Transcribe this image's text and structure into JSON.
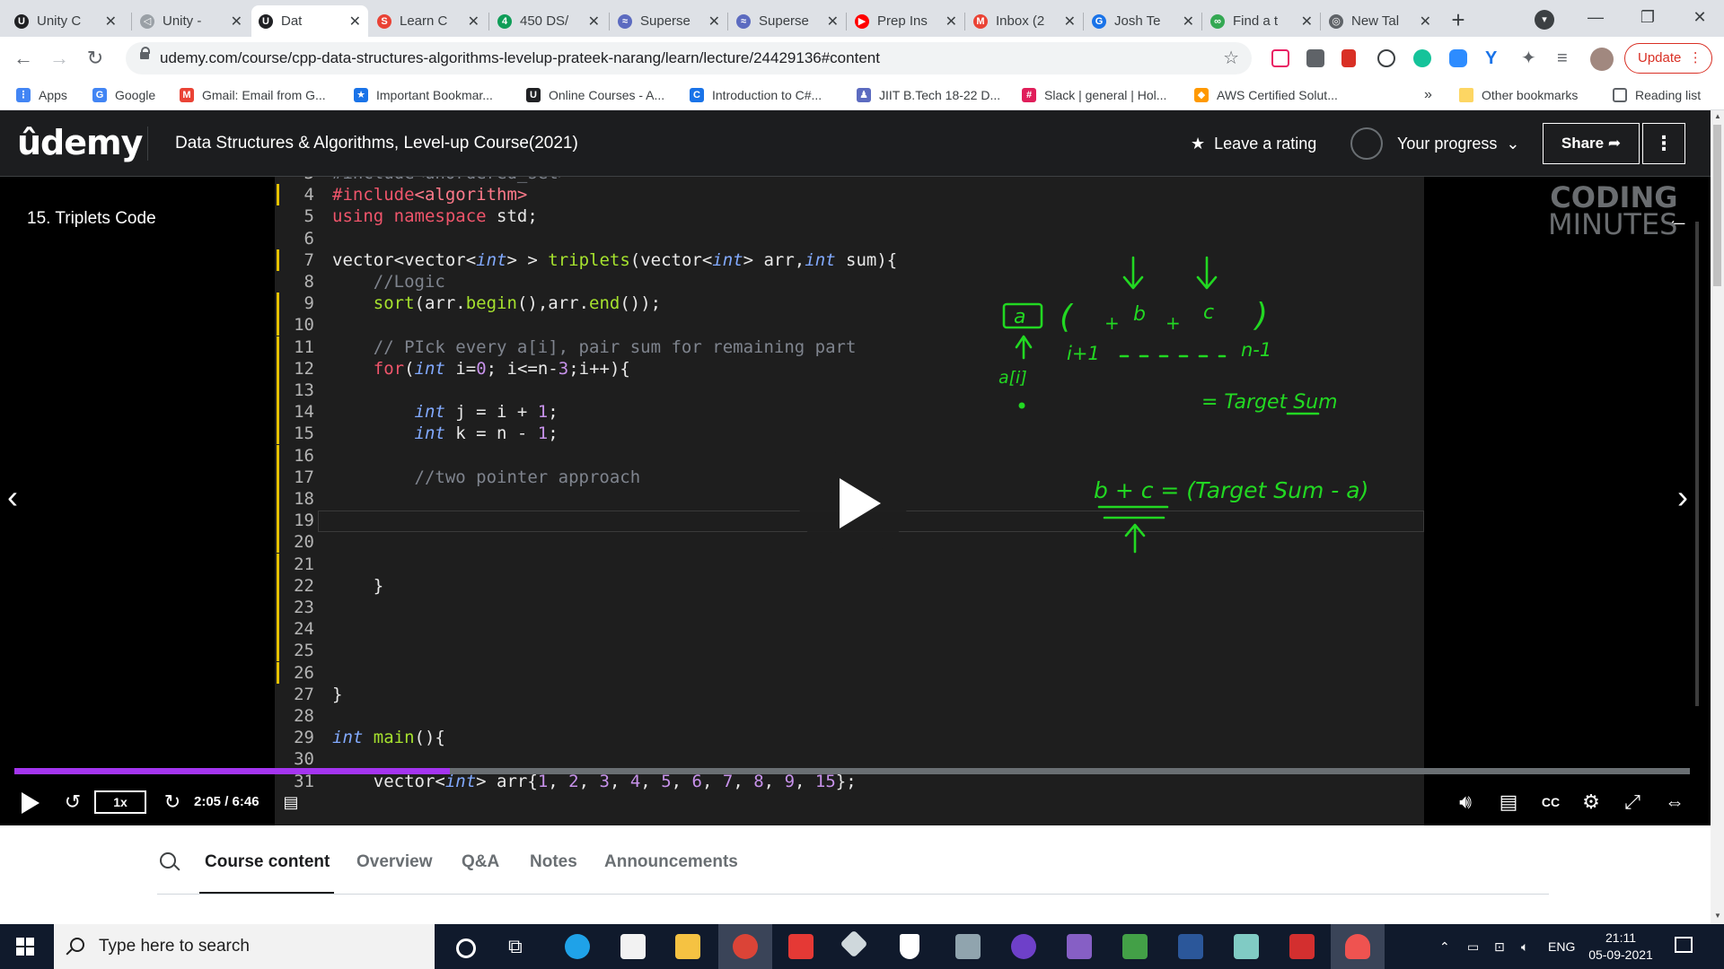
{
  "browser": {
    "tabs": [
      {
        "title": "Unity C",
        "color": "#202124",
        "glyph": "U"
      },
      {
        "title": "Unity - ",
        "color": "#9aa0a6",
        "glyph": "◁"
      },
      {
        "title": "Dat",
        "color": "#202124",
        "glyph": "U",
        "active": true
      },
      {
        "title": "Learn C",
        "color": "#e94235",
        "glyph": "S"
      },
      {
        "title": "450 DS/",
        "color": "#0f9d58",
        "glyph": "4"
      },
      {
        "title": "Superse",
        "color": "#5c6bc0",
        "glyph": "≈"
      },
      {
        "title": "Superse",
        "color": "#5c6bc0",
        "glyph": "≈"
      },
      {
        "title": "Prep Ins",
        "color": "#ff0000",
        "glyph": "▶"
      },
      {
        "title": "Inbox (2",
        "color": "#ea4335",
        "glyph": "M"
      },
      {
        "title": "Josh Te",
        "color": "#1a73e8",
        "glyph": "G"
      },
      {
        "title": "Find a t",
        "color": "#34a853",
        "glyph": "∞"
      },
      {
        "title": "New Tal",
        "color": "#5f6368",
        "glyph": "◎"
      }
    ],
    "new_tab": "+",
    "url": "udemy.com/course/cpp-data-structures-algorithms-levelup-prateek-narang/learn/lecture/24429136#content",
    "update_label": "Update"
  },
  "bookmarks": [
    {
      "label": "Apps",
      "color": "#4285f4",
      "glyph": "⋮"
    },
    {
      "label": "Google",
      "color": "#4285f4",
      "glyph": "G"
    },
    {
      "label": "Gmail: Email from G...",
      "color": "#ea4335",
      "glyph": "M"
    },
    {
      "label": "Important Bookmar...",
      "color": "#1a73e8",
      "glyph": "★"
    },
    {
      "label": "Online Courses - A...",
      "color": "#202124",
      "glyph": "U"
    },
    {
      "label": "Introduction to C#...",
      "color": "#1a73e8",
      "glyph": "C"
    },
    {
      "label": "JIIT B.Tech 18-22 D...",
      "color": "#5c6bc0",
      "glyph": "♟"
    },
    {
      "label": "Slack | general | Hol...",
      "color": "#e01e5a",
      "glyph": "#"
    },
    {
      "label": "AWS Certified Solut...",
      "color": "#ff9900",
      "glyph": "◆"
    }
  ],
  "bookmarks_more": "»",
  "bookmarks_other": "Other bookmarks",
  "bookmarks_reading": "Reading list",
  "udemy": {
    "logo": "ûdemy",
    "course_title": "Data Structures & Algorithms, Level-up Course(2021)",
    "leave_rating": "Leave a rating",
    "progress_label": "Your progress",
    "share_label": "Share"
  },
  "lecture_title": "15. Triplets Code",
  "watermark_line1": "CODING",
  "watermark_line2": "MINUTES",
  "player": {
    "speed": "1x",
    "time": "2:05 / 6:46",
    "progress": 0.2597
  },
  "course_tabs": [
    "Course content",
    "Overview",
    "Q&A",
    "Notes",
    "Announcements"
  ],
  "taskbar": {
    "search_placeholder": "Type here to search",
    "lang": "ENG",
    "time": "21:11",
    "date": "05-09-2021"
  },
  "annotations": {
    "tokens": [
      "a",
      "(",
      "+",
      "b",
      "+",
      "c",
      ")",
      "i+1",
      "n-1",
      "a[i]",
      "= Target Sum",
      "b + c = (Target Sum - a)"
    ]
  }
}
